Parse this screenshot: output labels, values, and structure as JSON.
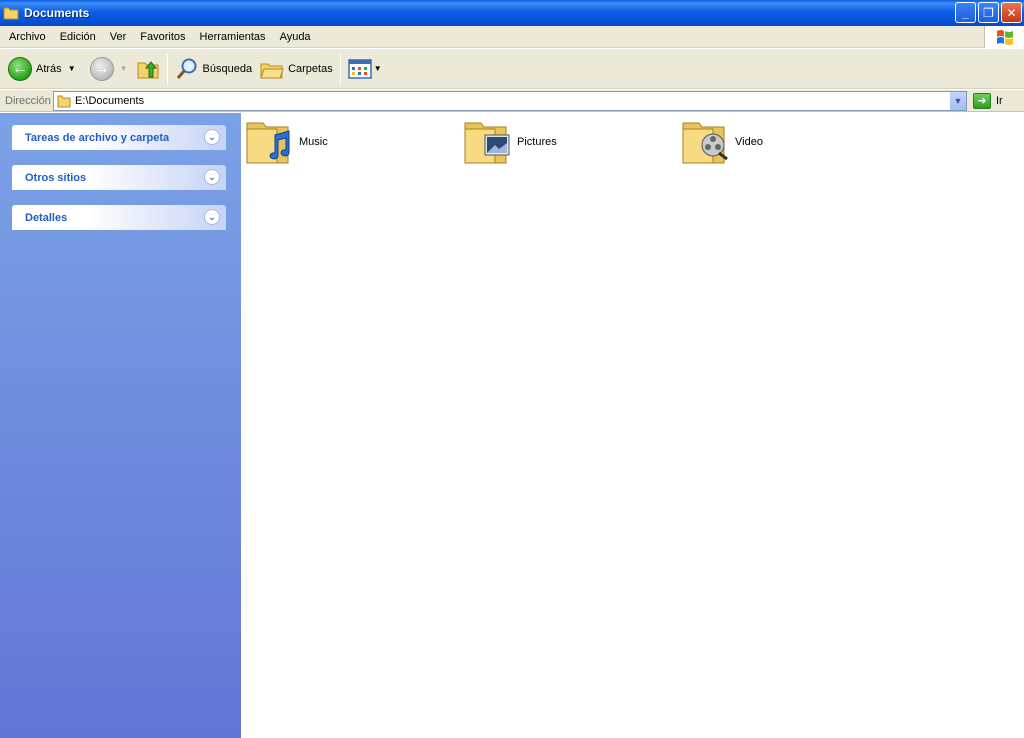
{
  "window": {
    "title": "Documents"
  },
  "menu": {
    "items": [
      "Archivo",
      "Edición",
      "Ver",
      "Favoritos",
      "Herramientas",
      "Ayuda"
    ]
  },
  "toolbar": {
    "back_label": "Atrás",
    "search_label": "Búsqueda",
    "folders_label": "Carpetas"
  },
  "address": {
    "label": "Dirección",
    "value": "E:\\Documents",
    "go_label": "Ir"
  },
  "taskpane": {
    "panels": [
      "Tareas de archivo y carpeta",
      "Otros sitios",
      "Detalles"
    ]
  },
  "content": {
    "items": [
      {
        "name": "Music",
        "icon": "music-folder-icon"
      },
      {
        "name": "Pictures",
        "icon": "pictures-folder-icon"
      },
      {
        "name": "Video",
        "icon": "video-folder-icon"
      }
    ]
  },
  "colors": {
    "titlebar": "#0b5ee6",
    "chrome": "#ece9d8",
    "taskpane_top": "#7ba2e7",
    "taskpane_bottom": "#6375d6",
    "panel_title": "#215dc6"
  }
}
